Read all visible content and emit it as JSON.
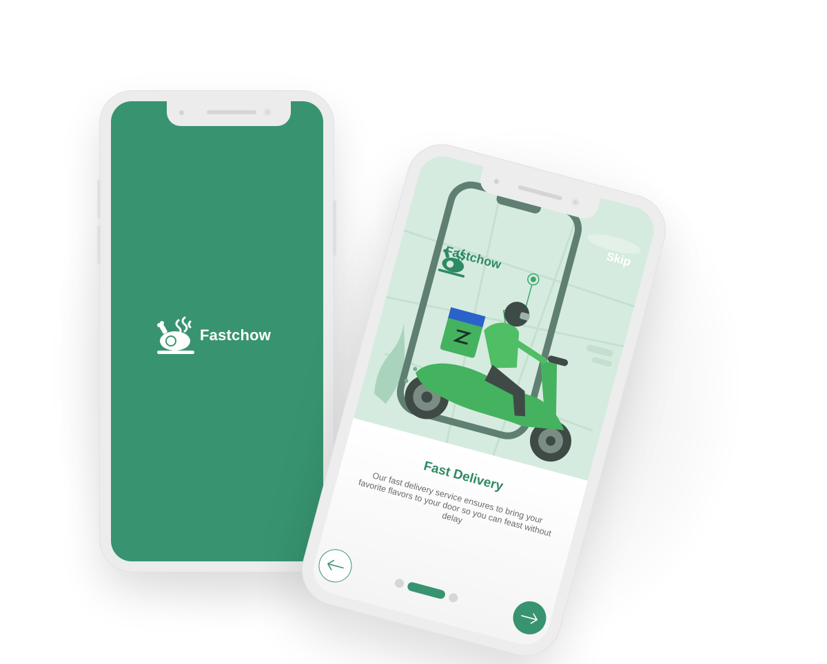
{
  "brand": "Fastchow",
  "splash": {
    "background_color": "#389470",
    "logo_text": "Fastchow"
  },
  "onboarding": {
    "skip_label": "Skip",
    "illustration_logo_text": "Fastchow",
    "title": "Fast Delivery",
    "description": "Our fast delivery service ensures to bring your favorite flavors to your door so you can feast without delay",
    "pagination": {
      "total": 3,
      "active_index": 1
    },
    "back_icon": "arrow-left-icon",
    "next_icon": "arrow-right-icon",
    "accent_color": "#389470"
  }
}
